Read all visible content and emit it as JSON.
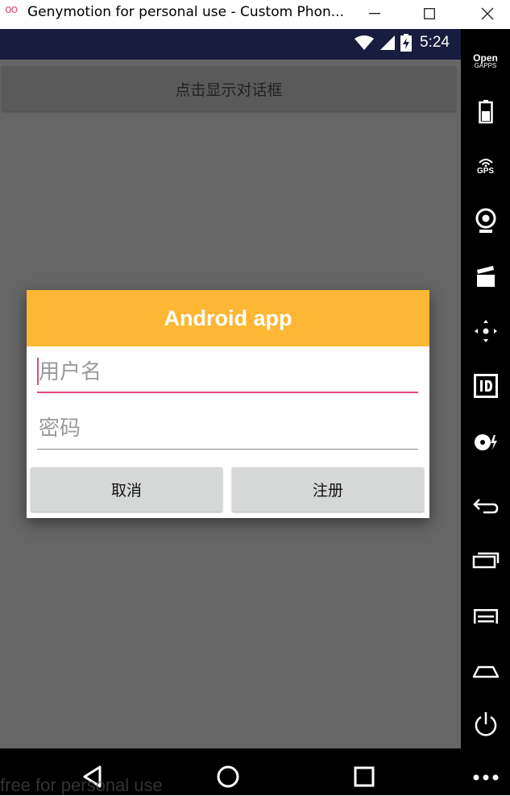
{
  "window": {
    "app_logo": "oo",
    "title": "Genymotion for personal use - Custom Phon..."
  },
  "statusbar": {
    "time": "5:24"
  },
  "screen": {
    "show_dialog_button": "点击显示对话框"
  },
  "dialog": {
    "title": "Android app",
    "username": {
      "value": "",
      "placeholder": "用户名"
    },
    "password": {
      "value": "",
      "placeholder": "密码"
    },
    "cancel_label": "取消",
    "register_label": "注册"
  },
  "sidebar": {
    "opengapps_line1": "Open",
    "opengapps_line2": "GAPPS",
    "gps_label": "GPS",
    "items": [
      "opengapps",
      "battery-icon",
      "gps-icon",
      "camera-icon",
      "media-icon",
      "dpad-icon",
      "id-icon",
      "disk-icon",
      "back-icon",
      "recent-apps-icon",
      "menu-icon",
      "home-icon",
      "power-icon",
      "more-icon"
    ]
  },
  "watermark": "free for personal use",
  "colors": {
    "dialog_header": "#fdb734",
    "accent": "#e8457a",
    "statusbar": "#181c3e",
    "screen_dim": "#666666"
  }
}
